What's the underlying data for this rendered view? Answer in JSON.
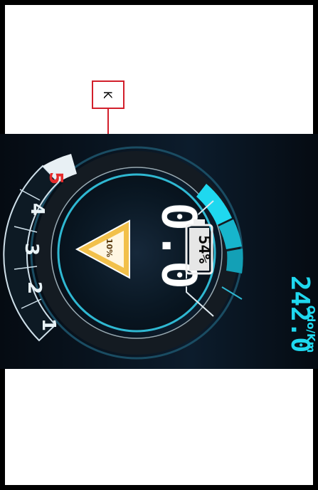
{
  "callout": {
    "label": "K"
  },
  "gears": {
    "items": [
      "1",
      "2",
      "3",
      "4",
      "5"
    ],
    "selected": "5"
  },
  "speed": {
    "value": "0.0"
  },
  "warning": {
    "text": "10%"
  },
  "battery": {
    "percent_text": "54%",
    "level": 0.54
  },
  "odometer": {
    "value": "242.0",
    "unit": "Odo/Km"
  },
  "colors": {
    "accent": "#1fd8ef",
    "gear_selected": "#e52b2b",
    "warning_fill": "#f2c04a",
    "callout": "#d21f2b"
  }
}
